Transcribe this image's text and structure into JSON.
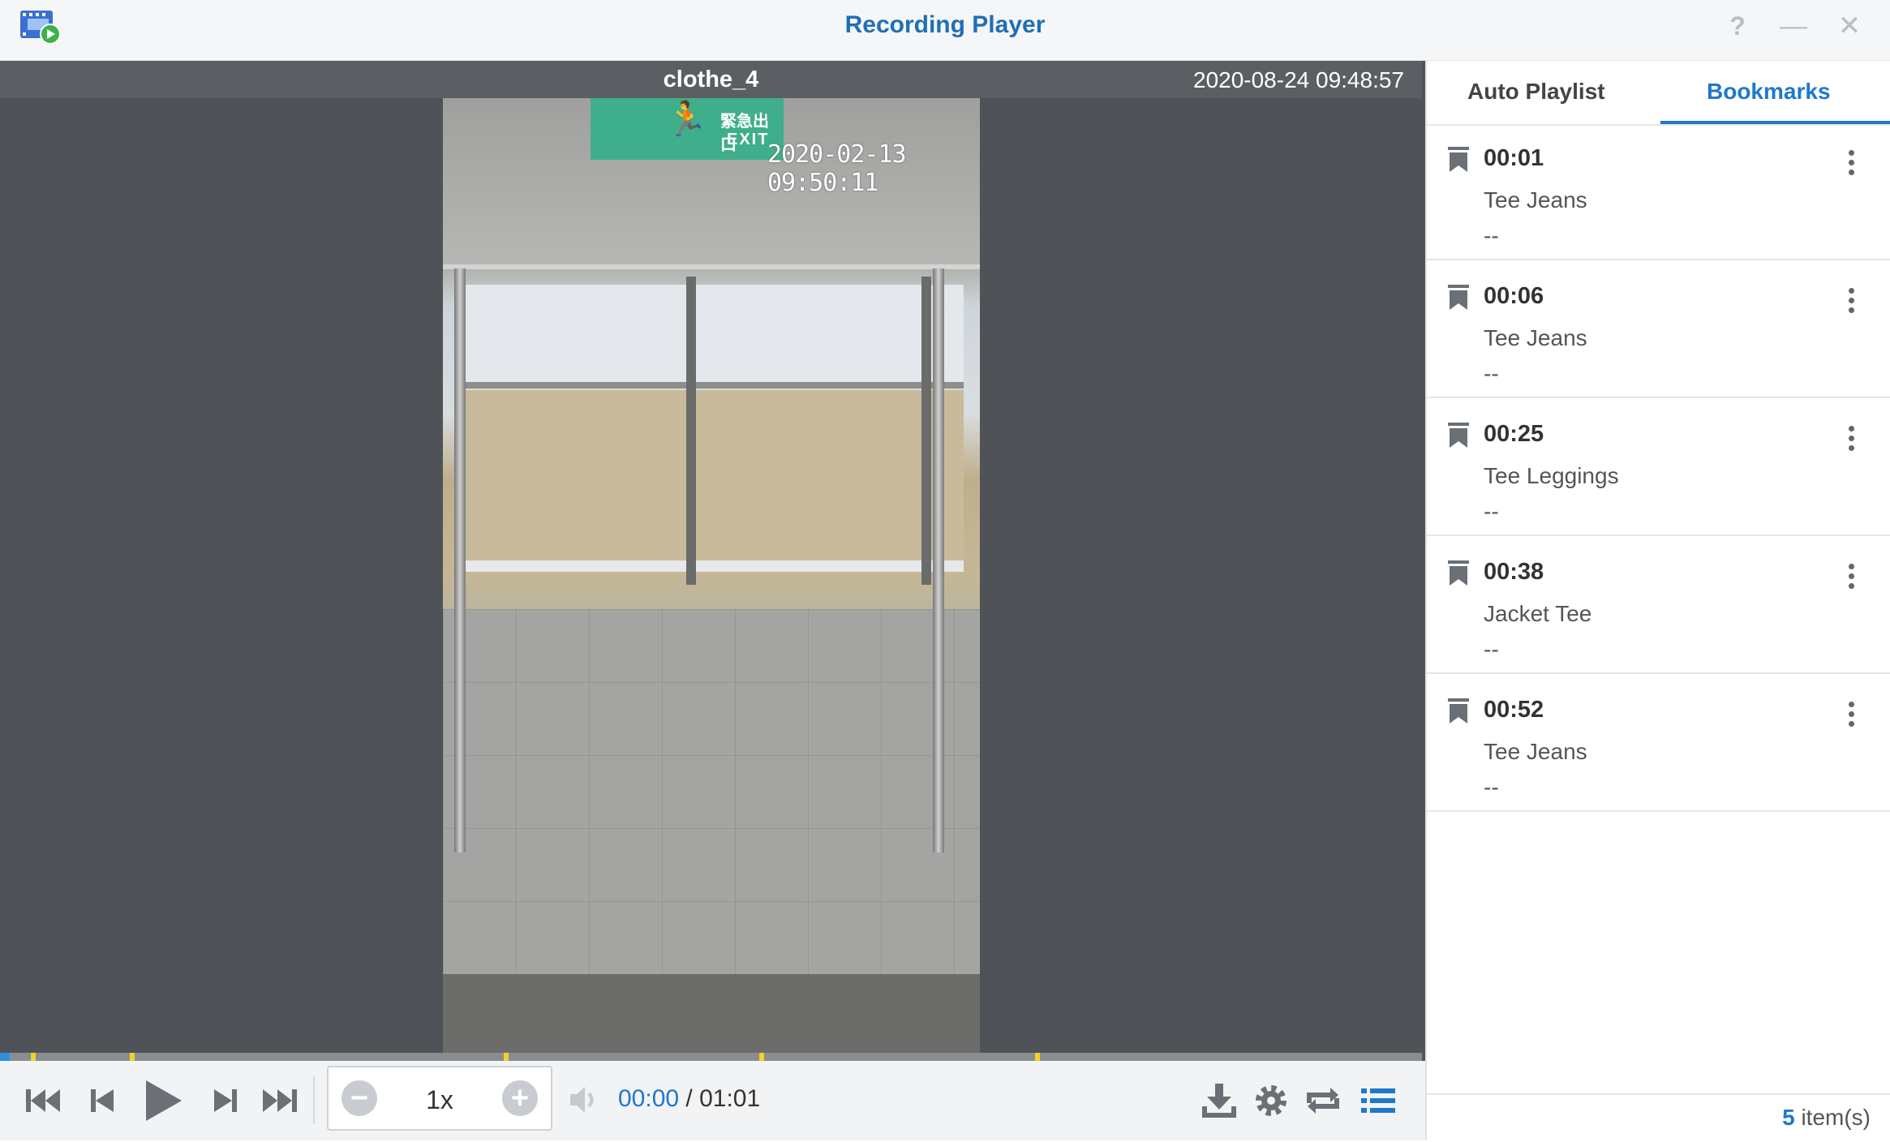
{
  "window": {
    "title": "Recording Player",
    "help_label": "?",
    "minimize_label": "—",
    "close_label": "✕"
  },
  "video": {
    "camera_name": "clothe_4",
    "datetime": "2020-08-24 09:48:57",
    "overlay_timestamp": "2020-02-13 09:50:11",
    "exit_sign_cjk": "緊急出口",
    "exit_sign_en": "EXIT"
  },
  "timeline": {
    "progress_fraction": 0.0,
    "bookmark_positions_seconds": [
      1,
      6,
      25,
      38,
      52
    ],
    "duration_seconds": 61,
    "progress_color": "#2b8fde",
    "marker_color": "#f0d12a"
  },
  "controls": {
    "speed": "1x",
    "speed_minus": "−",
    "speed_plus": "+",
    "current_time": "00:00",
    "time_separator": " / ",
    "total_time": "01:01",
    "icons": [
      "skip-to-start-icon",
      "previous-frame-icon",
      "play-icon",
      "next-frame-icon",
      "skip-to-end-icon",
      "volume-icon",
      "download-icon",
      "settings-gear-icon",
      "repeat-icon",
      "playlist-toggle-icon"
    ]
  },
  "sidebar": {
    "tabs": [
      "Auto Playlist",
      "Bookmarks"
    ],
    "active_tab": "Bookmarks",
    "bookmarks": [
      {
        "time": "00:01",
        "label": "Tee Jeans",
        "desc": "--"
      },
      {
        "time": "00:06",
        "label": "Tee Jeans",
        "desc": "--"
      },
      {
        "time": "00:25",
        "label": "Tee Leggings",
        "desc": "--"
      },
      {
        "time": "00:38",
        "label": "Jacket Tee",
        "desc": "--"
      },
      {
        "time": "00:52",
        "label": "Tee Jeans",
        "desc": "--"
      }
    ],
    "item_count": "5",
    "item_count_suffix": " item(s)"
  },
  "colors": {
    "accent": "#1f78c9",
    "title": "#1f6fb5",
    "player_bg": "#4f5256"
  }
}
